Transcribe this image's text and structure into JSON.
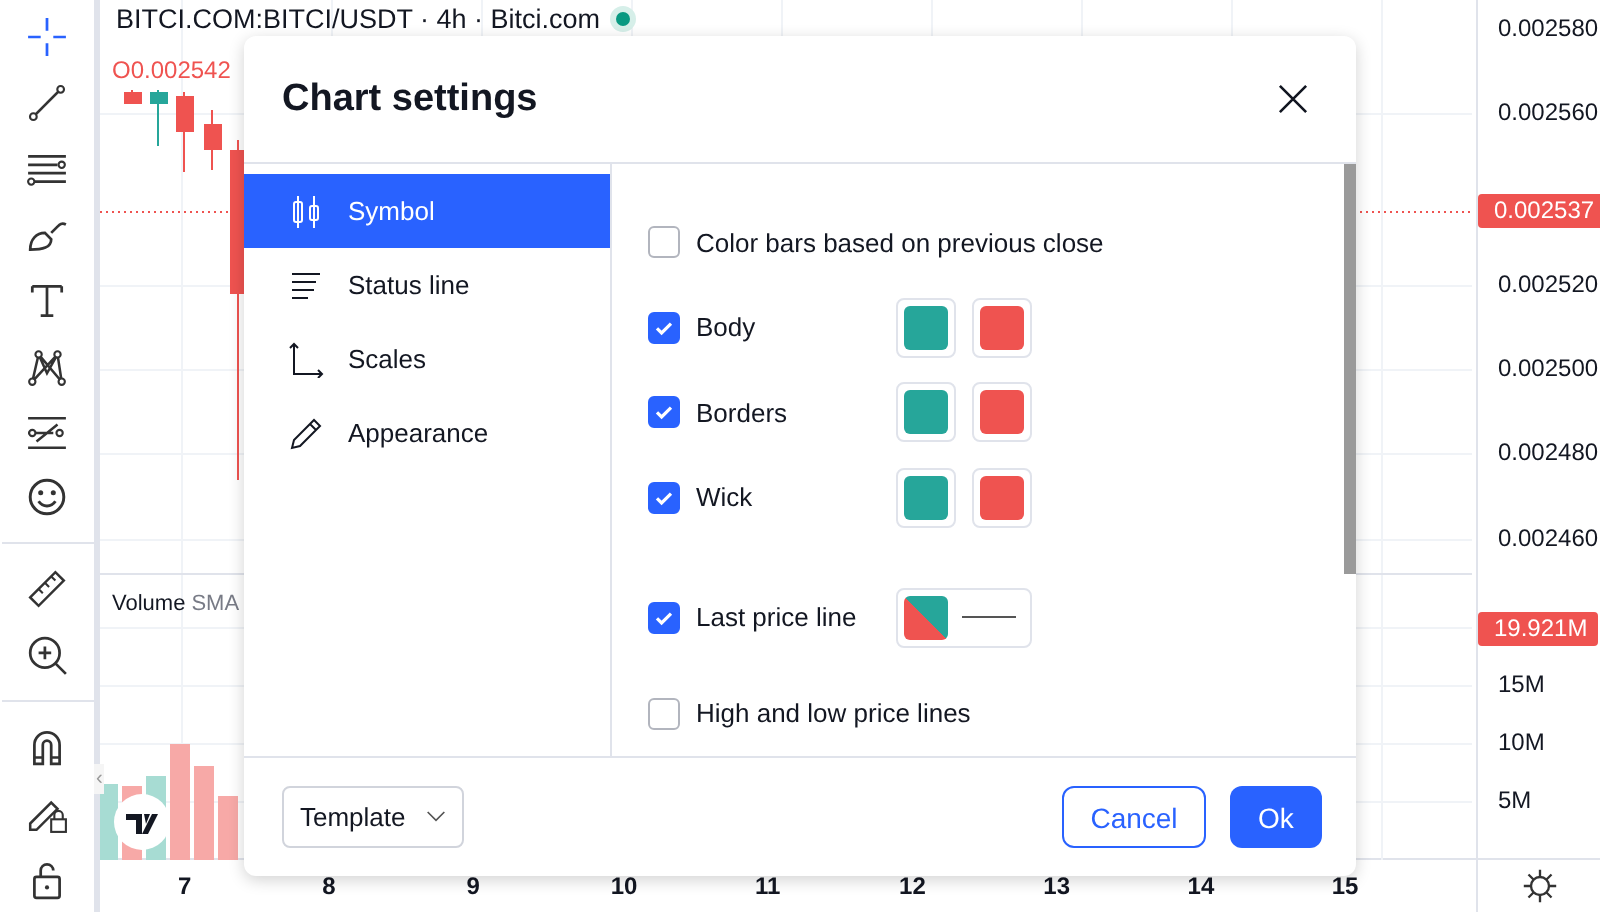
{
  "chart": {
    "symbol_title": "BITCI.COM:BITCI/USDT · 4h · Bitci.com",
    "ohlc": "O0.002542",
    "volume_label": "Volume",
    "volume_sma": "SMA",
    "price_ticks": [
      "0.002580",
      "0.002560",
      "0.002520",
      "0.002500",
      "0.002480",
      "0.002460"
    ],
    "last_price": "0.002537",
    "volume_badge": "19.921M",
    "volume_ticks": [
      "15M",
      "10M",
      "5M"
    ],
    "time_ticks": [
      "7",
      "8",
      "9",
      "10",
      "11",
      "12",
      "13",
      "14",
      "15"
    ],
    "collapse_handle": "‹"
  },
  "dialog": {
    "title": "Chart settings",
    "nav": [
      {
        "label": "Symbol",
        "selected": true
      },
      {
        "label": "Status line",
        "selected": false
      },
      {
        "label": "Scales",
        "selected": false
      },
      {
        "label": "Appearance",
        "selected": false
      }
    ],
    "settings": [
      {
        "kind": "plain",
        "label": "Color bars based on previous close",
        "checked": false
      },
      {
        "kind": "colors",
        "label": "Body",
        "checked": true,
        "swatches": [
          {
            "color": "#26a69a"
          },
          {
            "color": "#ef5350"
          }
        ]
      },
      {
        "kind": "colors",
        "label": "Borders",
        "checked": true,
        "swatches": [
          {
            "color": "#26a69a"
          },
          {
            "color": "#ef5350"
          }
        ]
      },
      {
        "kind": "colors",
        "label": "Wick",
        "checked": true,
        "swatches": [
          {
            "color": "#26a69a"
          },
          {
            "color": "#ef5350"
          }
        ]
      },
      {
        "kind": "line",
        "label": "Last price line",
        "checked": true,
        "swatches": [
          {
            "color": "#26a69a"
          },
          {
            "color": "#ef5350"
          }
        ]
      },
      {
        "kind": "plain",
        "label": "High and low price lines",
        "checked": false
      }
    ],
    "template": "Template",
    "cancel": "Cancel",
    "ok": "Ok"
  }
}
